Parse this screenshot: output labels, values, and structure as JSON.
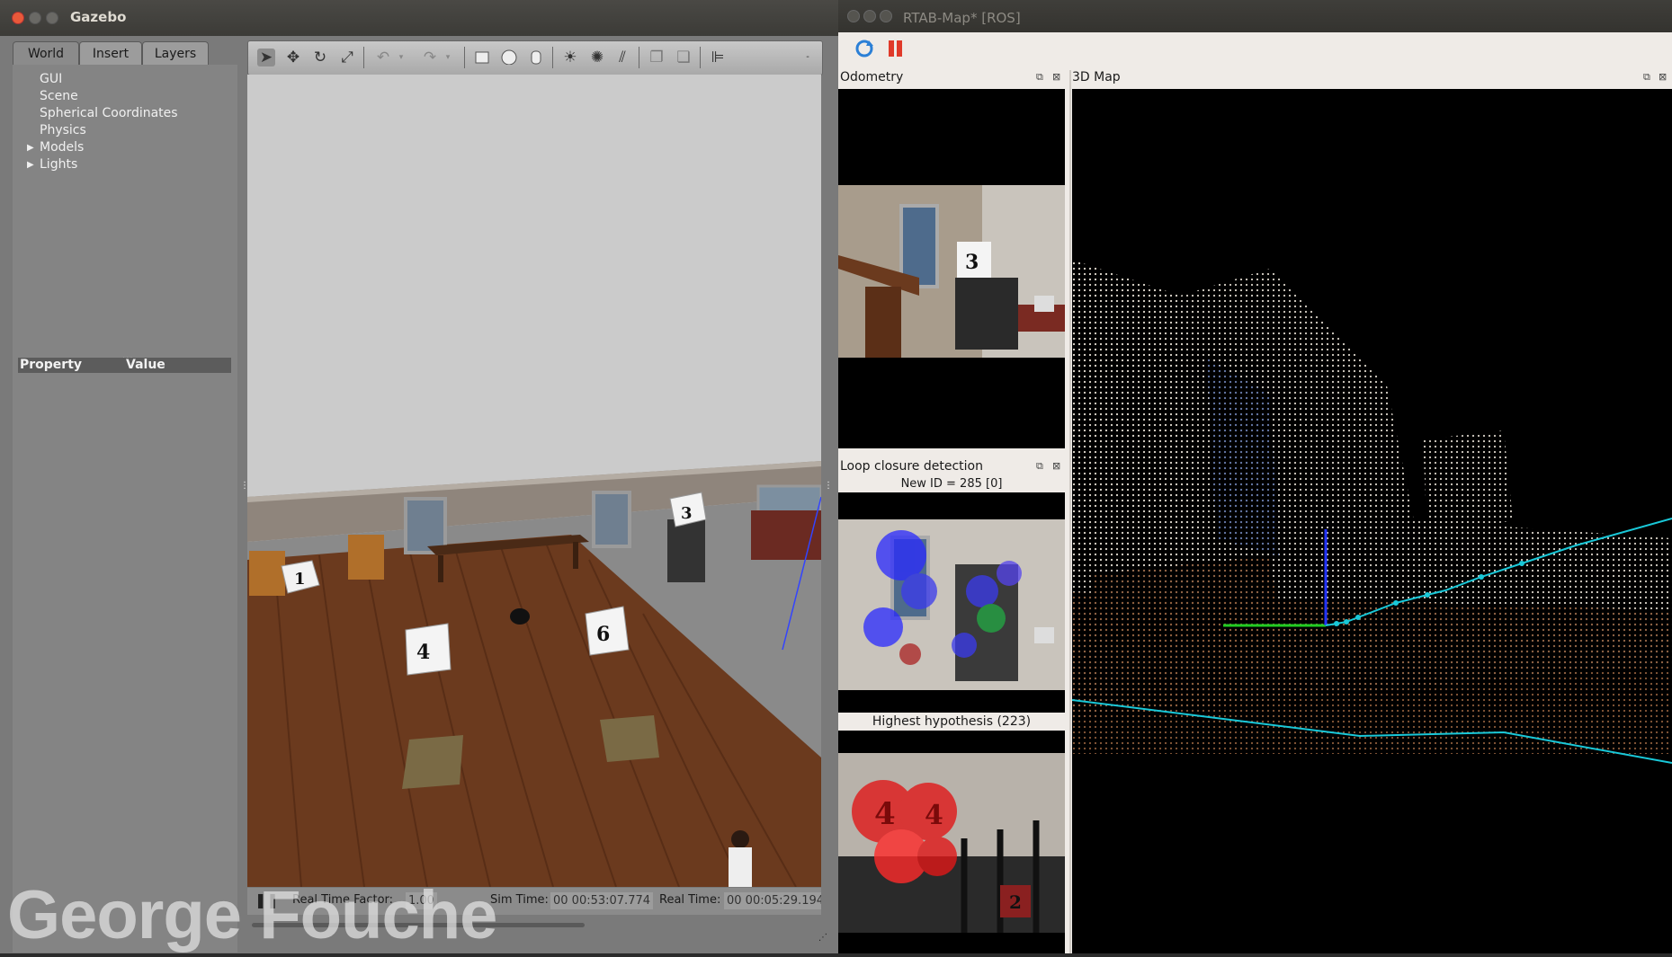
{
  "gazebo": {
    "title": "Gazebo",
    "tabs": [
      "World",
      "Insert",
      "Layers"
    ],
    "tree": [
      "GUI",
      "Scene",
      "Spherical Coordinates",
      "Physics",
      "Models",
      "Lights"
    ],
    "property_header": "Property",
    "value_header": "Value",
    "stats": {
      "rtf_label": "Real Time Factor:",
      "rtf_value": "1.00",
      "sim_label": "Sim Time:",
      "sim_value": "00 00:53:07.774",
      "real_label": "Real Time:",
      "real_value": "00 00:05:29.194"
    },
    "dice": [
      "1",
      "3",
      "4",
      "6"
    ]
  },
  "rtabmap": {
    "title": "RTAB-Map* [ROS]",
    "odometry_title": "Odometry",
    "map_title": "3D Map",
    "loop_title": "Loop closure detection",
    "new_id": "New ID = 285 [0]",
    "highest_hypothesis": "Highest hypothesis (223)",
    "dice_labels": [
      "3",
      "4",
      "4",
      "2"
    ]
  },
  "watermark": "George Fouche",
  "colors": {
    "path_cyan": "#19c8d8",
    "axis_green": "#22cc22",
    "axis_blue": "#2233ff",
    "pause_red": "#e03a2a"
  }
}
